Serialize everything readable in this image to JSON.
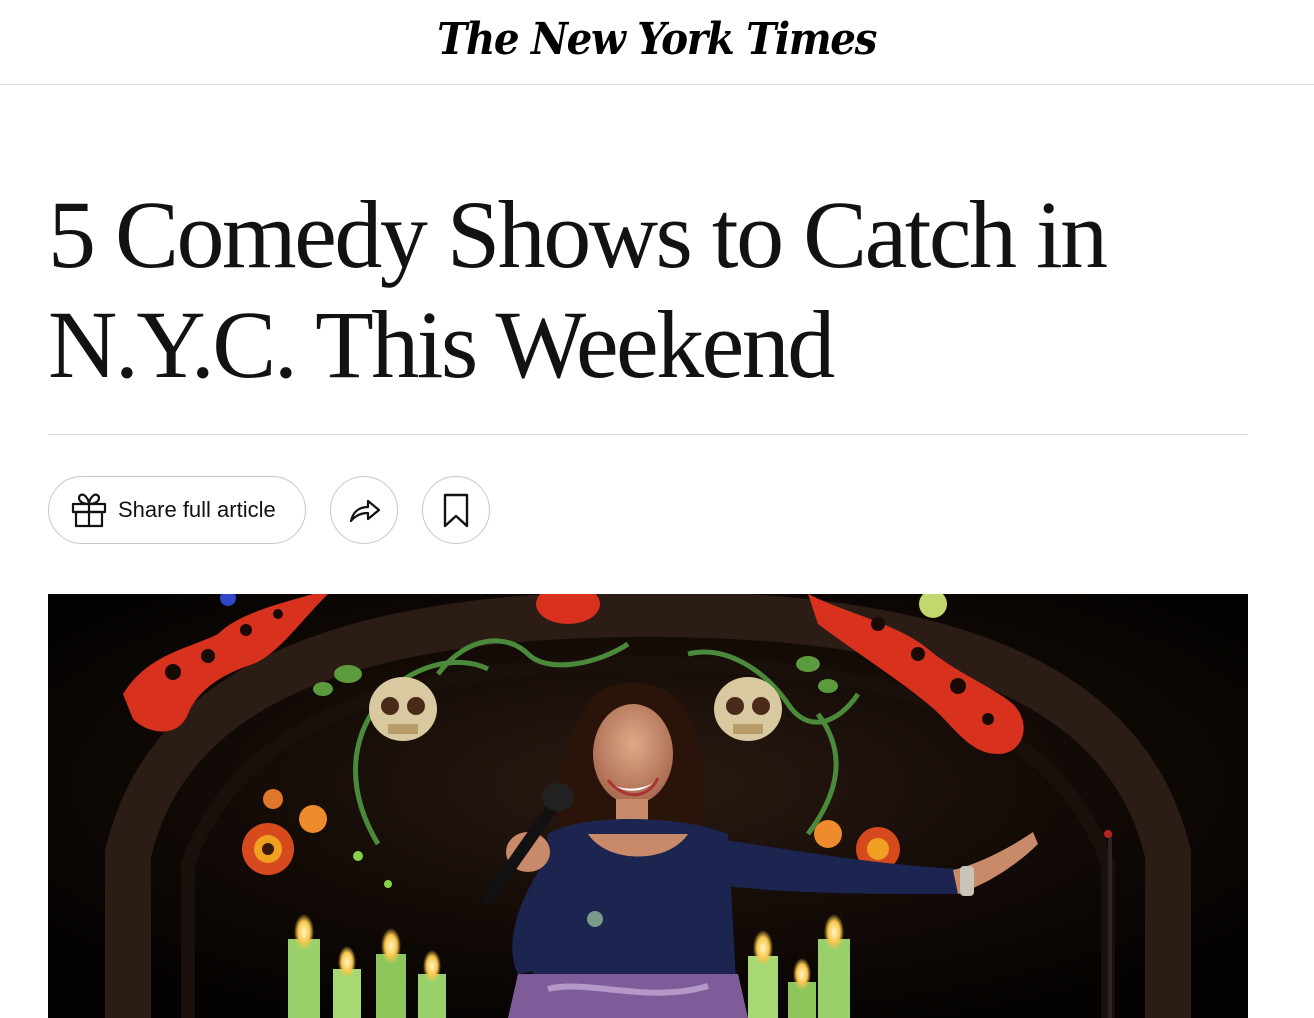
{
  "masthead": {
    "logo_text": "The New York Times"
  },
  "article": {
    "headline": "5 Comedy Shows to Catch in N.Y.C. This Weekend"
  },
  "actions": {
    "share_label": "Share full article",
    "icons": {
      "share": "gift-icon",
      "forward": "share-arrow-icon",
      "save": "bookmark-icon"
    }
  },
  "hero_image": {
    "subject": "comedian-on-stage-photo"
  }
}
